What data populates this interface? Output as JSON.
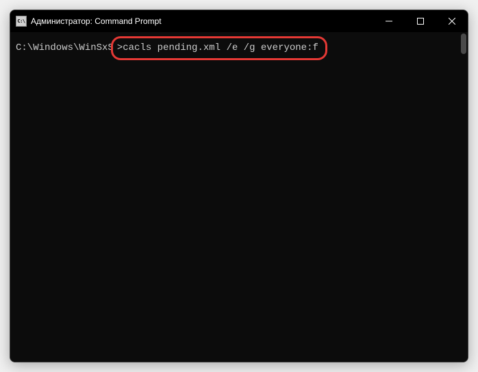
{
  "titlebar": {
    "icon_label": "C:\\",
    "title": "Администратор: Command Prompt"
  },
  "terminal": {
    "prompt_path": "C:\\Windows\\WinSxS",
    "prompt_separator": ">",
    "command": "cacls pending.xml /e /g everyone:f"
  },
  "highlight_color": "#e53935"
}
